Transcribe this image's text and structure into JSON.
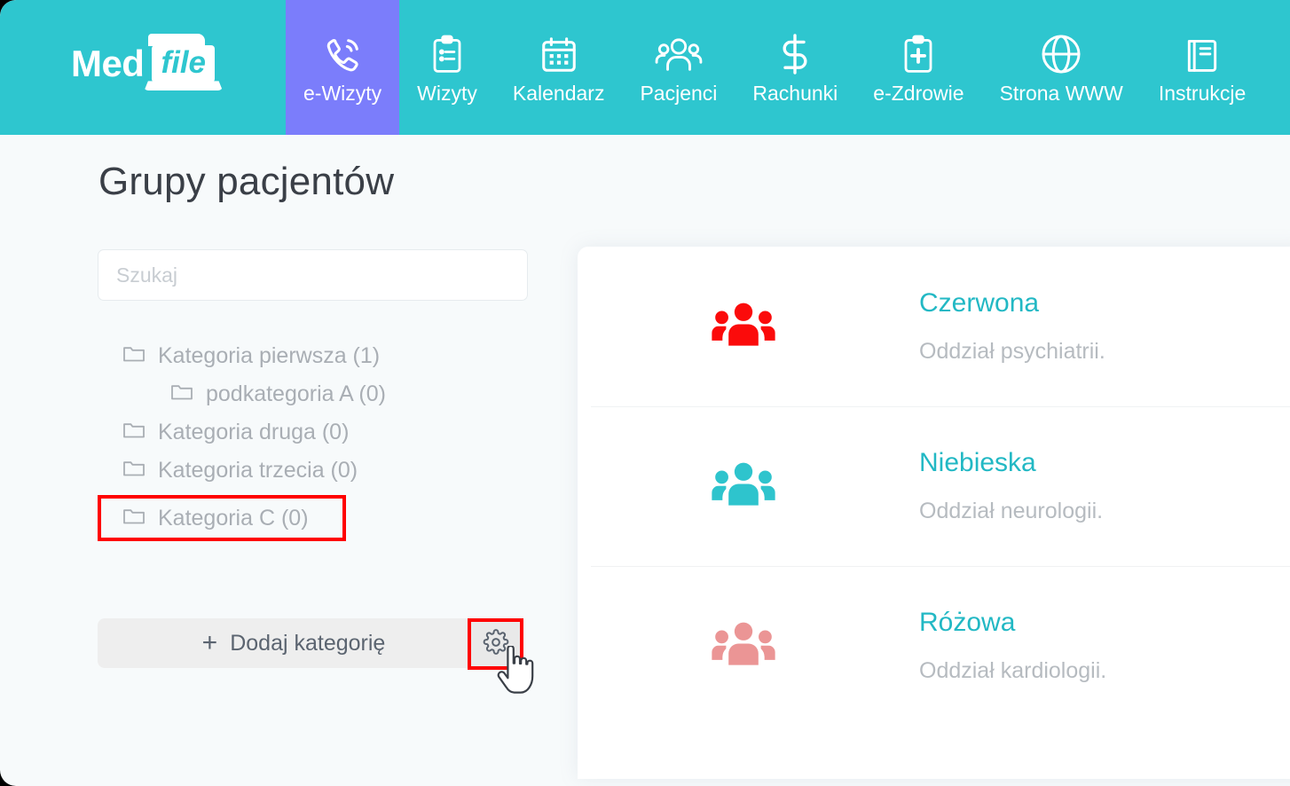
{
  "brand": {
    "part1": "Med",
    "part2": "file"
  },
  "nav": {
    "items": [
      {
        "label": "e-Wizyty",
        "icon": "phone-call-icon",
        "active": true
      },
      {
        "label": "Wizyty",
        "icon": "clipboard-list-icon",
        "active": false
      },
      {
        "label": "Kalendarz",
        "icon": "calendar-icon",
        "active": false
      },
      {
        "label": "Pacjenci",
        "icon": "people-group-icon",
        "active": false
      },
      {
        "label": "Rachunki",
        "icon": "dollar-sign-icon",
        "active": false
      },
      {
        "label": "e-Zdrowie",
        "icon": "clipboard-medical-icon",
        "active": false
      },
      {
        "label": "Strona WWW",
        "icon": "globe-icon",
        "active": false
      },
      {
        "label": "Instrukcje",
        "icon": "book-icon",
        "active": false
      }
    ]
  },
  "page": {
    "title": "Grupy pacjentów"
  },
  "search": {
    "value": "",
    "placeholder": "Szukaj"
  },
  "tree": {
    "items": [
      {
        "label": "Kategoria pierwsza (1)",
        "depth": 0,
        "highlighted": false
      },
      {
        "label": "podkategoria A (0)",
        "depth": 1,
        "highlighted": false
      },
      {
        "label": "Kategoria druga (0)",
        "depth": 0,
        "highlighted": false
      },
      {
        "label": "Kategoria trzecia (0)",
        "depth": 0,
        "highlighted": false
      },
      {
        "label": "Kategoria C (0)",
        "depth": 0,
        "highlighted": true
      }
    ]
  },
  "actions": {
    "add_category_label": "Dodaj kategorię",
    "add_category_plus": "+",
    "settings_icon": "gear-icon"
  },
  "groups": {
    "items": [
      {
        "name": "Czerwona",
        "description": "Oddział psychiatrii.",
        "color": "#fb0b0b"
      },
      {
        "name": "Niebieska",
        "description": "Oddział neurologii.",
        "color": "#2ec4cd"
      },
      {
        "name": "Różowa",
        "description": "Oddział kardiologii.",
        "color": "#eb9595"
      }
    ]
  },
  "colors": {
    "brand_teal": "#2ec6cf",
    "active_tab_purple": "#7b7dfb",
    "link_teal": "#22b8c4",
    "annotation_red": "#ff0000",
    "page_bg": "#f7fafb"
  }
}
